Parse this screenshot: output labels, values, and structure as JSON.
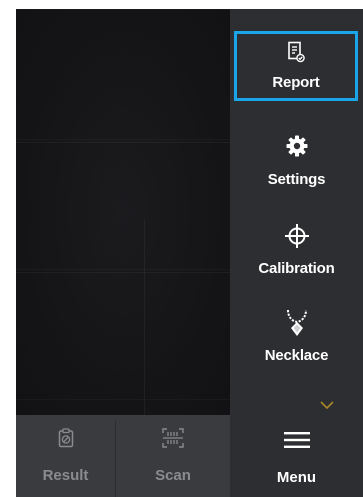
{
  "sidebar": {
    "items": [
      {
        "label": "Report",
        "icon": "report-icon",
        "selected": true
      },
      {
        "label": "Settings",
        "icon": "gear-icon"
      },
      {
        "label": "Calibration",
        "icon": "crosshair-icon"
      },
      {
        "label": "Necklace",
        "icon": "necklace-icon"
      }
    ],
    "more_icon": "chevron-down-icon"
  },
  "bottombar": {
    "result": {
      "label": "Result",
      "icon": "result-icon"
    },
    "scan": {
      "label": "Scan",
      "icon": "barcode-scan-icon"
    },
    "menu": {
      "label": "Menu",
      "icon": "hamburger-menu-icon"
    }
  },
  "colors": {
    "highlight": "#1aa5e8",
    "sidebar_bg": "#2d2e31",
    "bottombar_bg": "#3a3b3e",
    "chevron": "#a8882a",
    "disabled_text": "#8a8b8e"
  }
}
